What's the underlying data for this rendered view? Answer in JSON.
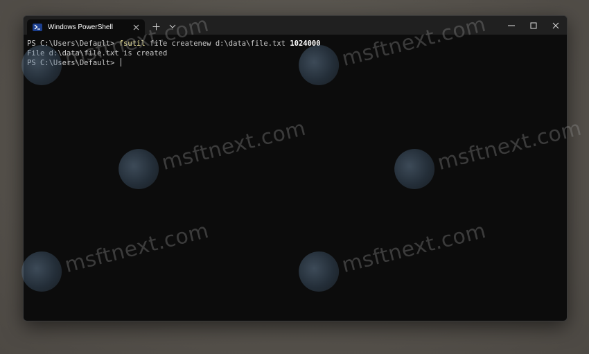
{
  "window": {
    "tab_title": "Windows PowerShell",
    "tab_icon": "powershell-icon",
    "buttons": {
      "minimize": "minimize-icon",
      "maximize": "maximize-icon",
      "close": "close-icon"
    }
  },
  "terminal": {
    "line1": {
      "prompt": "PS C:\\Users\\Default> ",
      "command": "fsutil",
      "args": " file createnew d:\\data\\file.txt ",
      "number": "1024000"
    },
    "line2": {
      "text": "File d:\\data\\file.txt is created"
    },
    "line3": {
      "prompt": "PS C:\\Users\\Default> "
    }
  },
  "watermark": {
    "text": "msftnext.com"
  },
  "colors": {
    "terminal_bg": "#0c0c0c",
    "titlebar_bg": "#202020",
    "command": "#f9f1a5",
    "text": "#cccccc"
  }
}
